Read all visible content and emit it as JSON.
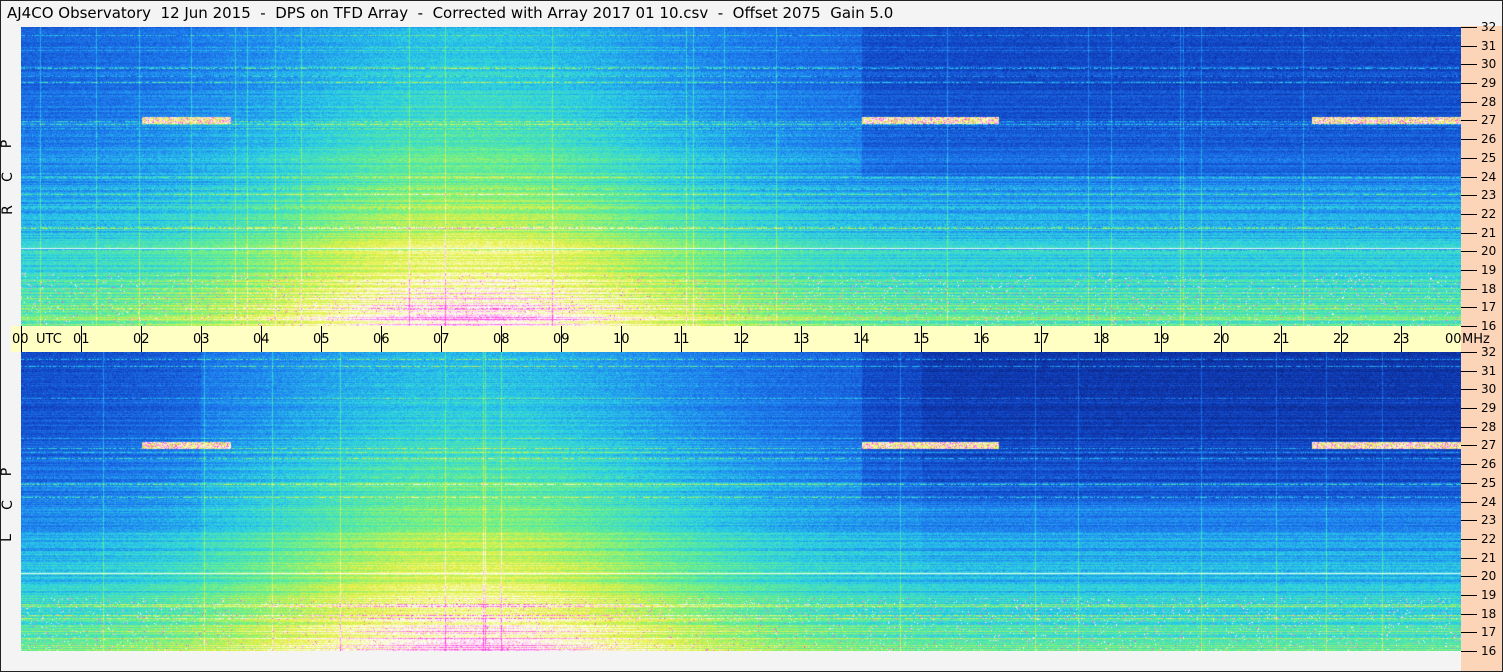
{
  "title": "AJ4CO Observatory  12 Jun 2015  -  DPS on TFD Array  -  Corrected with Array 2017 01 10.csv  -  Offset 2075  Gain 5.0",
  "chart_data": {
    "type": "heatmap",
    "title": "AJ4CO Observatory  12 Jun 2015  -  DPS on TFD Array  -  Corrected with Array 2017 01 10.csv  -  Offset 2075  Gain 5.0",
    "xlabel": "UTC",
    "ylabel": "MHz",
    "x_ticks": [
      "00",
      "01",
      "02",
      "03",
      "04",
      "05",
      "06",
      "07",
      "08",
      "09",
      "10",
      "11",
      "12",
      "13",
      "14",
      "15",
      "16",
      "17",
      "18",
      "19",
      "20",
      "21",
      "22",
      "23",
      "00"
    ],
    "y_ticks": [
      "32",
      "31",
      "30",
      "29",
      "28",
      "27",
      "26",
      "25",
      "24",
      "23",
      "22",
      "21",
      "20",
      "19",
      "18",
      "17",
      "16"
    ],
    "xlim": [
      0,
      24
    ],
    "ylim": [
      16,
      32
    ],
    "panels": [
      {
        "name": "RCP",
        "letters": [
          "R",
          "C",
          "P"
        ]
      },
      {
        "name": "LCP",
        "letters": [
          "L",
          "C",
          "P"
        ]
      }
    ],
    "colormap": [
      "#0a1a6a",
      "#1040c0",
      "#1e7cf0",
      "#2ad0e6",
      "#6af08a",
      "#e8f040",
      "#ffffff",
      "#ff40e0"
    ]
  }
}
